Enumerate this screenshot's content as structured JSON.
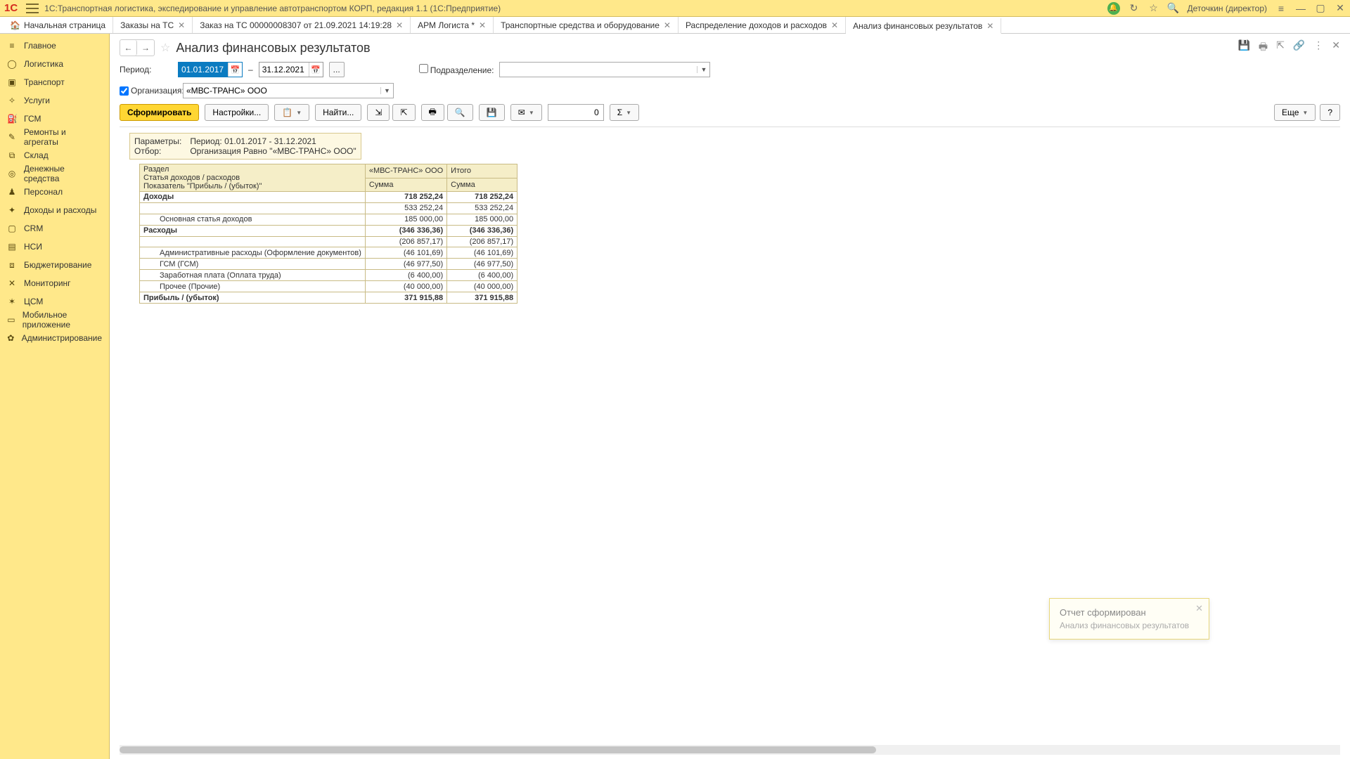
{
  "app": {
    "title": "1С:Транспортная логистика, экспедирование и управление автотранспортом КОРП, редакция 1.1  (1С:Предприятие)",
    "user": "Деточкин (директор)"
  },
  "tabs": [
    {
      "label": "Начальная страница",
      "home": true
    },
    {
      "label": "Заказы на ТС",
      "closable": true
    },
    {
      "label": "Заказ на ТС 00000008307 от 21.09.2021 14:19:28",
      "closable": true
    },
    {
      "label": "АРМ Логиста *",
      "closable": true
    },
    {
      "label": "Транспортные средства и оборудование",
      "closable": true
    },
    {
      "label": "Распределение доходов и расходов",
      "closable": true
    },
    {
      "label": "Анализ финансовых результатов",
      "closable": true,
      "active": true
    }
  ],
  "sidebar": [
    {
      "icon": "≡",
      "label": "Главное"
    },
    {
      "icon": "◯",
      "label": "Логистика"
    },
    {
      "icon": "▣",
      "label": "Транспорт"
    },
    {
      "icon": "✧",
      "label": "Услуги"
    },
    {
      "icon": "⛽",
      "label": "ГСМ"
    },
    {
      "icon": "✎",
      "label": "Ремонты и агрегаты"
    },
    {
      "icon": "⧉",
      "label": "Склад"
    },
    {
      "icon": "◎",
      "label": "Денежные средства"
    },
    {
      "icon": "♟",
      "label": "Персонал"
    },
    {
      "icon": "✦",
      "label": "Доходы и расходы"
    },
    {
      "icon": "▢",
      "label": "CRM"
    },
    {
      "icon": "▤",
      "label": "НСИ"
    },
    {
      "icon": "⧈",
      "label": "Бюджетирование"
    },
    {
      "icon": "✕",
      "label": "Мониторинг"
    },
    {
      "icon": "✶",
      "label": "ЦСМ"
    },
    {
      "icon": "▭",
      "label": "Мобильное приложение"
    },
    {
      "icon": "✿",
      "label": "Администрирование"
    }
  ],
  "page": {
    "title": "Анализ финансовых результатов",
    "period_label": "Период:",
    "date_from": "01.01.2017",
    "date_to": "31.12.2021",
    "org_label": "Организация:",
    "org_value": "«МВС-ТРАНС» ООО",
    "div_label": "Подразделение:",
    "div_value": ""
  },
  "toolbar": {
    "generate": "Сформировать",
    "settings": "Настройки...",
    "find": "Найти...",
    "num_value": "0",
    "more": "Еще",
    "help": "?"
  },
  "report": {
    "param_lbl": "Параметры:",
    "param_val": "Период: 01.01.2017 - 31.12.2021",
    "filter_lbl": "Отбор:",
    "filter_val": "Организация Равно \"«МВС-ТРАНС» ООО\"",
    "headers": {
      "section": "Раздел",
      "article": "Статья доходов / расходов",
      "indicator": "Показатель \"Прибыль / (убыток)\"",
      "org": "«МВС-ТРАНС» ООО",
      "total": "Итого",
      "sum": "Сумма"
    },
    "rows": [
      {
        "label": "Доходы",
        "v1": "718 252,24",
        "v2": "718 252,24",
        "bold": true,
        "expand": true
      },
      {
        "label": "",
        "v1": "533 252,24",
        "v2": "533 252,24",
        "ind": 1
      },
      {
        "label": "Основная статья доходов",
        "v1": "185 000,00",
        "v2": "185 000,00",
        "ind": 2
      },
      {
        "label": "Расходы",
        "v1": "(346 336,36)",
        "v2": "(346 336,36)",
        "bold": true,
        "expand": true
      },
      {
        "label": "",
        "v1": "(206 857,17)",
        "v2": "(206 857,17)",
        "ind": 1
      },
      {
        "label": "Административные расходы (Оформление документов)",
        "v1": "(46 101,69)",
        "v2": "(46 101,69)",
        "ind": 2
      },
      {
        "label": "ГСМ (ГСМ)",
        "v1": "(46 977,50)",
        "v2": "(46 977,50)",
        "ind": 2
      },
      {
        "label": "Заработная плата (Оплата труда)",
        "v1": "(6 400,00)",
        "v2": "(6 400,00)",
        "ind": 2
      },
      {
        "label": "Прочее (Прочие)",
        "v1": "(40 000,00)",
        "v2": "(40 000,00)",
        "ind": 2
      },
      {
        "label": "Прибыль / (убыток)",
        "v1": "371 915,88",
        "v2": "371 915,88",
        "bold": true
      }
    ]
  },
  "toast": {
    "title": "Отчет сформирован",
    "body": "Анализ финансовых результатов"
  }
}
